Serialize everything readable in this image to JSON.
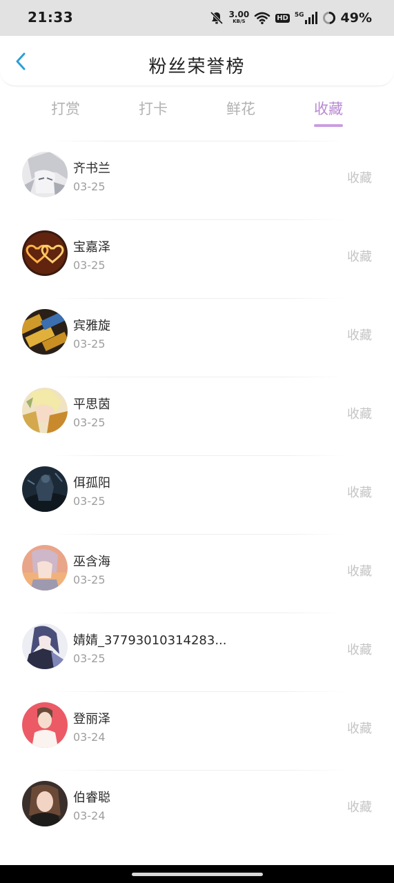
{
  "status_bar": {
    "time": "21:33",
    "net_speed_value": "3.00",
    "net_speed_unit": "KB/S",
    "hd_label": "HD",
    "network_label": "5G",
    "battery_percent": "49%",
    "icons": [
      "mute-bell-icon",
      "wifi-icon",
      "hd-icon",
      "signal-5g-icon",
      "battery-ring-icon"
    ]
  },
  "header": {
    "title": "粉丝荣誉榜",
    "back_icon": "chevron-left-icon",
    "accent_color": "#2a9fd6"
  },
  "tabs": {
    "items": [
      {
        "label": "打赏"
      },
      {
        "label": "打卡"
      },
      {
        "label": "鲜花"
      },
      {
        "label": "收藏"
      }
    ],
    "active_label": "收藏",
    "active_color": "#b889d4",
    "inactive_color": "#b2b2b2"
  },
  "list": {
    "rows": [
      {
        "name": "齐书兰",
        "date": "03-25",
        "action": "收藏"
      },
      {
        "name": "宝嘉泽",
        "date": "03-25",
        "action": "收藏"
      },
      {
        "name": "宾雅旋",
        "date": "03-25",
        "action": "收藏"
      },
      {
        "name": "平思茵",
        "date": "03-25",
        "action": "收藏"
      },
      {
        "name": "佴孤阳",
        "date": "03-25",
        "action": "收藏"
      },
      {
        "name": "巫含海",
        "date": "03-25",
        "action": "收藏"
      },
      {
        "name": "婧婧_37793010314283...",
        "date": "03-25",
        "action": "收藏"
      },
      {
        "name": "登丽泽",
        "date": "03-24",
        "action": "收藏"
      },
      {
        "name": "伯睿聪",
        "date": "03-24",
        "action": "收藏"
      }
    ]
  }
}
